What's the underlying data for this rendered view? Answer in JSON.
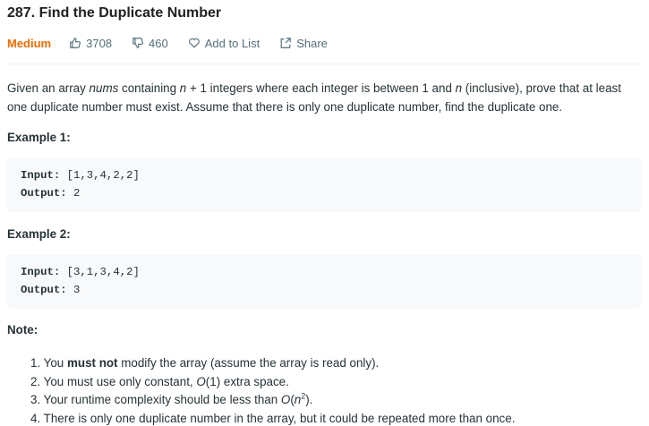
{
  "problem": {
    "title": "287. Find the Duplicate Number",
    "difficulty": "Medium",
    "colors": {
      "difficulty": "#ef6c00",
      "text": "#263238",
      "muted": "#546e7a",
      "code_bg": "#f7f9fa"
    }
  },
  "meta": {
    "likes": "3708",
    "dislikes": "460",
    "add_to_list": "Add to List",
    "share": "Share",
    "icons": [
      "thumbs-up-icon",
      "thumbs-down-icon",
      "heart-icon",
      "share-icon"
    ]
  },
  "description": {
    "p1": "Given an array ",
    "nums": "nums",
    "p2": " containing ",
    "n1": "n",
    "p3": " + 1 integers where each integer is between 1 and ",
    "n2": "n",
    "p4": " (inclusive), prove that at least one duplicate number must exist. Assume that there is only one duplicate number, find the duplicate one."
  },
  "examples": [
    {
      "heading": "Example 1:",
      "input_label": "Input:",
      "input_value": " [1,3,4,2,2]",
      "output_label": "Output:",
      "output_value": " 2"
    },
    {
      "heading": "Example 2:",
      "input_label": "Input:",
      "input_value": " [3,1,3,4,2]",
      "output_label": "Output:",
      "output_value": " 3"
    }
  ],
  "note": {
    "heading": "Note:",
    "items": [
      {
        "num": "1. ",
        "pre": "You ",
        "bold": "must not",
        "post": " modify the array (assume the array is read only)."
      },
      {
        "num": "2. ",
        "pre": "You must use only constant, ",
        "math": "O",
        "post": "(1) extra space."
      },
      {
        "num": "3. ",
        "pre": "Your runtime complexity should be less than ",
        "math": "O",
        "paren_open": "(",
        "n": "n",
        "sup": "2",
        "post": ")."
      },
      {
        "num": "4. ",
        "pre": "There is only one duplicate number in the array, but it could be repeated more than once."
      }
    ]
  }
}
